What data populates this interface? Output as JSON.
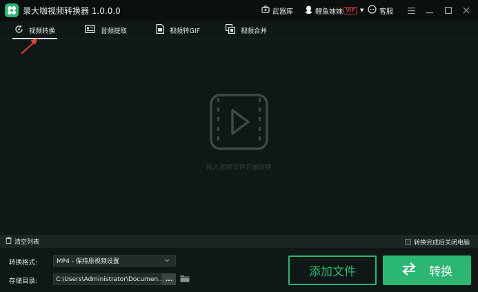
{
  "app": {
    "title": "录大咖视频转换器 1.0.0.0",
    "icon": "clover-logo-icon"
  },
  "titlebar": {
    "toolbox": "武器库",
    "user": "鲤鱼妹妹",
    "vip_badge": "VIP",
    "support": "客服"
  },
  "tabs": [
    {
      "label": "视频转换",
      "icon": "video-convert-icon",
      "active": true
    },
    {
      "label": "音频提取",
      "icon": "audio-extract-icon",
      "active": false
    },
    {
      "label": "视频转GIF",
      "icon": "gif-file-icon",
      "active": false
    },
    {
      "label": "视频合并",
      "icon": "merge-icon",
      "active": false
    }
  ],
  "drop_zone": {
    "hint": "拖入视频文件开始转换",
    "icon": "video-play-icon"
  },
  "listbar": {
    "clear_label": "清空列表",
    "shutdown_label": "转换完成后关闭电脑",
    "shutdown_checked": false
  },
  "settings": {
    "format_label": "转换格式:",
    "format_value": "MP4 - 保持原视频设置",
    "dir_label": "存储目录:",
    "dir_value": "C:\\Users\\Administrator\\Documen...",
    "browse_label": "..."
  },
  "actions": {
    "add_label": "添加文件",
    "convert_label": "转换"
  },
  "colors": {
    "accent": "#2bb673",
    "background": "#0f1816",
    "titlebar": "#0b100f",
    "annotation_arrow": "#e3413a"
  }
}
